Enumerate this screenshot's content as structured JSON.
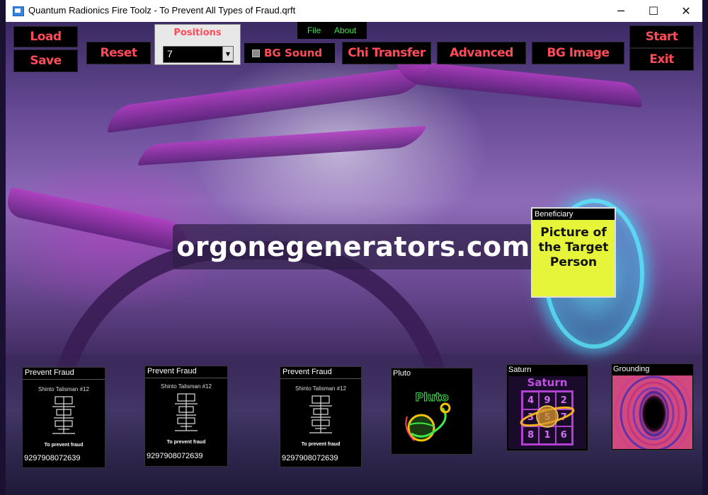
{
  "window": {
    "title": "Quantum Radionics Fire Toolz - To Prevent All Types of Fraud.qrft",
    "controls": {
      "minimize": "─",
      "maximize": "☐",
      "close": "✕"
    }
  },
  "toolbar": {
    "load": "Load",
    "save": "Save",
    "reset": "Reset",
    "positions_label": "Positions",
    "positions_value": "7",
    "bg_sound": "BG Sound",
    "chi_transfer": "Chi Transfer",
    "advanced": "Advanced",
    "bg_image": "BG Image",
    "start": "Start",
    "exit": "Exit"
  },
  "menu": {
    "file": "File",
    "about": "About"
  },
  "banner": "orgonegenerators.com",
  "beneficiary": {
    "header": "Beneficiary",
    "text": "Picture of the Target Person"
  },
  "cards": [
    {
      "title": "Prevent Fraud",
      "subtitle": "Shinto Talisman #12",
      "caption": "To prevent fraud",
      "number": "9297908072639"
    },
    {
      "title": "Prevent Fraud",
      "subtitle": "Shinto Talisman #12",
      "caption": "To prevent fraud",
      "number": "9297908072639"
    },
    {
      "title": "Prevent Fraud",
      "subtitle": "Shinto Talisman #12",
      "caption": "To prevent fraud",
      "number": "9297908072639"
    }
  ],
  "pluto": {
    "title": "Pluto",
    "label": "Pluto"
  },
  "saturn": {
    "title": "Saturn",
    "label": "Saturn",
    "grid": [
      "4",
      "9",
      "2",
      "3",
      "5",
      "7",
      "8",
      "1",
      "6"
    ]
  },
  "grounding": {
    "title": "Grounding"
  },
  "colors": {
    "accent_red": "#ff4b59",
    "menu_green": "#3ce84a",
    "beneficiary_yellow": "#e6f53a"
  }
}
